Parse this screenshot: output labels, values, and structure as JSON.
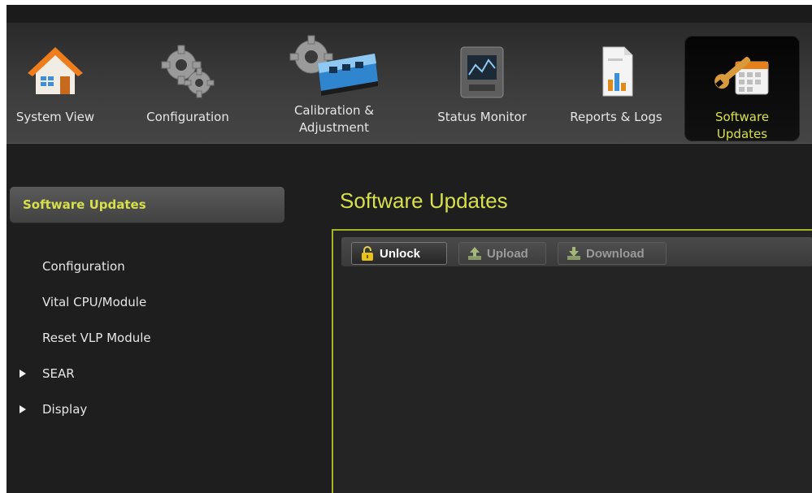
{
  "toolbar": {
    "items": [
      {
        "label": "System View",
        "icon": "house-icon"
      },
      {
        "label": "Configuration",
        "icon": "gears-icon"
      },
      {
        "label": "Calibration &\nAdjustment",
        "icon": "train-gear-icon"
      },
      {
        "label": "Status Monitor",
        "icon": "monitor-icon"
      },
      {
        "label": "Reports & Logs",
        "icon": "report-document-icon"
      },
      {
        "label": "Software\nUpdates",
        "icon": "wrench-calendar-icon",
        "active": true
      }
    ]
  },
  "sidebar": {
    "header": "Software Updates",
    "items": [
      {
        "label": "Configuration"
      },
      {
        "label": "Vital CPU/Module"
      },
      {
        "label": "Reset VLP Module"
      },
      {
        "label": "SEAR",
        "expandable": true
      },
      {
        "label": "Display",
        "expandable": true
      }
    ]
  },
  "main": {
    "title": "Software Updates",
    "actions": {
      "unlock": "Unlock",
      "upload": "Upload",
      "download": "Download"
    }
  },
  "colors": {
    "accent": "#d7e04a",
    "panel_border": "#a4b327",
    "background": "#1e1e1e"
  }
}
